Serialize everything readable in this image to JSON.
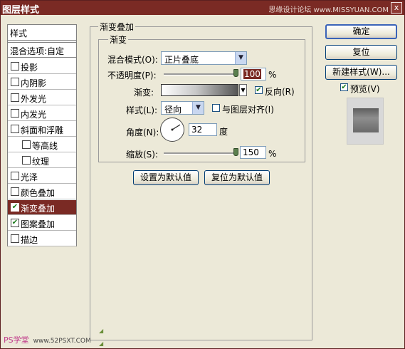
{
  "window": {
    "title": "图层样式",
    "watermark": "思缘设计论坛 www.MISSYUAN.COM",
    "close_glyph": "x"
  },
  "sidebar": {
    "header": "样式",
    "blend_options": "混合选项:自定",
    "items": [
      {
        "label": "投影",
        "checked": false
      },
      {
        "label": "内阴影",
        "checked": false
      },
      {
        "label": "外发光",
        "checked": false
      },
      {
        "label": "内发光",
        "checked": false
      },
      {
        "label": "斜面和浮雕",
        "checked": false
      },
      {
        "label": "等高线",
        "checked": false
      },
      {
        "label": "纹理",
        "checked": false
      },
      {
        "label": "光泽",
        "checked": false
      },
      {
        "label": "颜色叠加",
        "checked": false
      },
      {
        "label": "渐变叠加",
        "checked": true,
        "selected": true
      },
      {
        "label": "图案叠加",
        "checked": true
      },
      {
        "label": "描边",
        "checked": false
      }
    ]
  },
  "panel": {
    "group_title": "渐变叠加",
    "sub_group_title": "渐变",
    "blend_mode_label": "混合模式(O):",
    "blend_mode_value": "正片叠底",
    "opacity_label": "不透明度(P):",
    "opacity_value": "100",
    "opacity_unit": "%",
    "opacity_level": 1.0,
    "gradient_label": "渐变:",
    "reverse_label": "反向(R)",
    "reverse_checked": true,
    "style_label": "样式(L):",
    "style_value": "径向",
    "align_label": "与图层对齐(I)",
    "align_checked": false,
    "angle_label": "角度(N):",
    "angle_value": "32",
    "angle_unit": "度",
    "scale_label": "缩放(S):",
    "scale_value": "150",
    "scale_unit": "%",
    "scale_level": 1.0,
    "set_default": "设置为默认值",
    "reset_default": "复位为默认值"
  },
  "buttons": {
    "ok": "确定",
    "reset": "复位",
    "new_style": "新建样式(W)...",
    "preview_label": "预览(V)",
    "preview_checked": true
  },
  "footer": {
    "logo": "PS学堂",
    "site": "www.52PSXT.COM"
  },
  "icons": {
    "dropdown": "chevron-down-icon",
    "check": "checkmark-icon",
    "resize": "resize-grip-icon"
  },
  "colors": {
    "titlebar": "#7a2a24",
    "selection": "#7a2a24",
    "check": "#1a7a1a"
  }
}
